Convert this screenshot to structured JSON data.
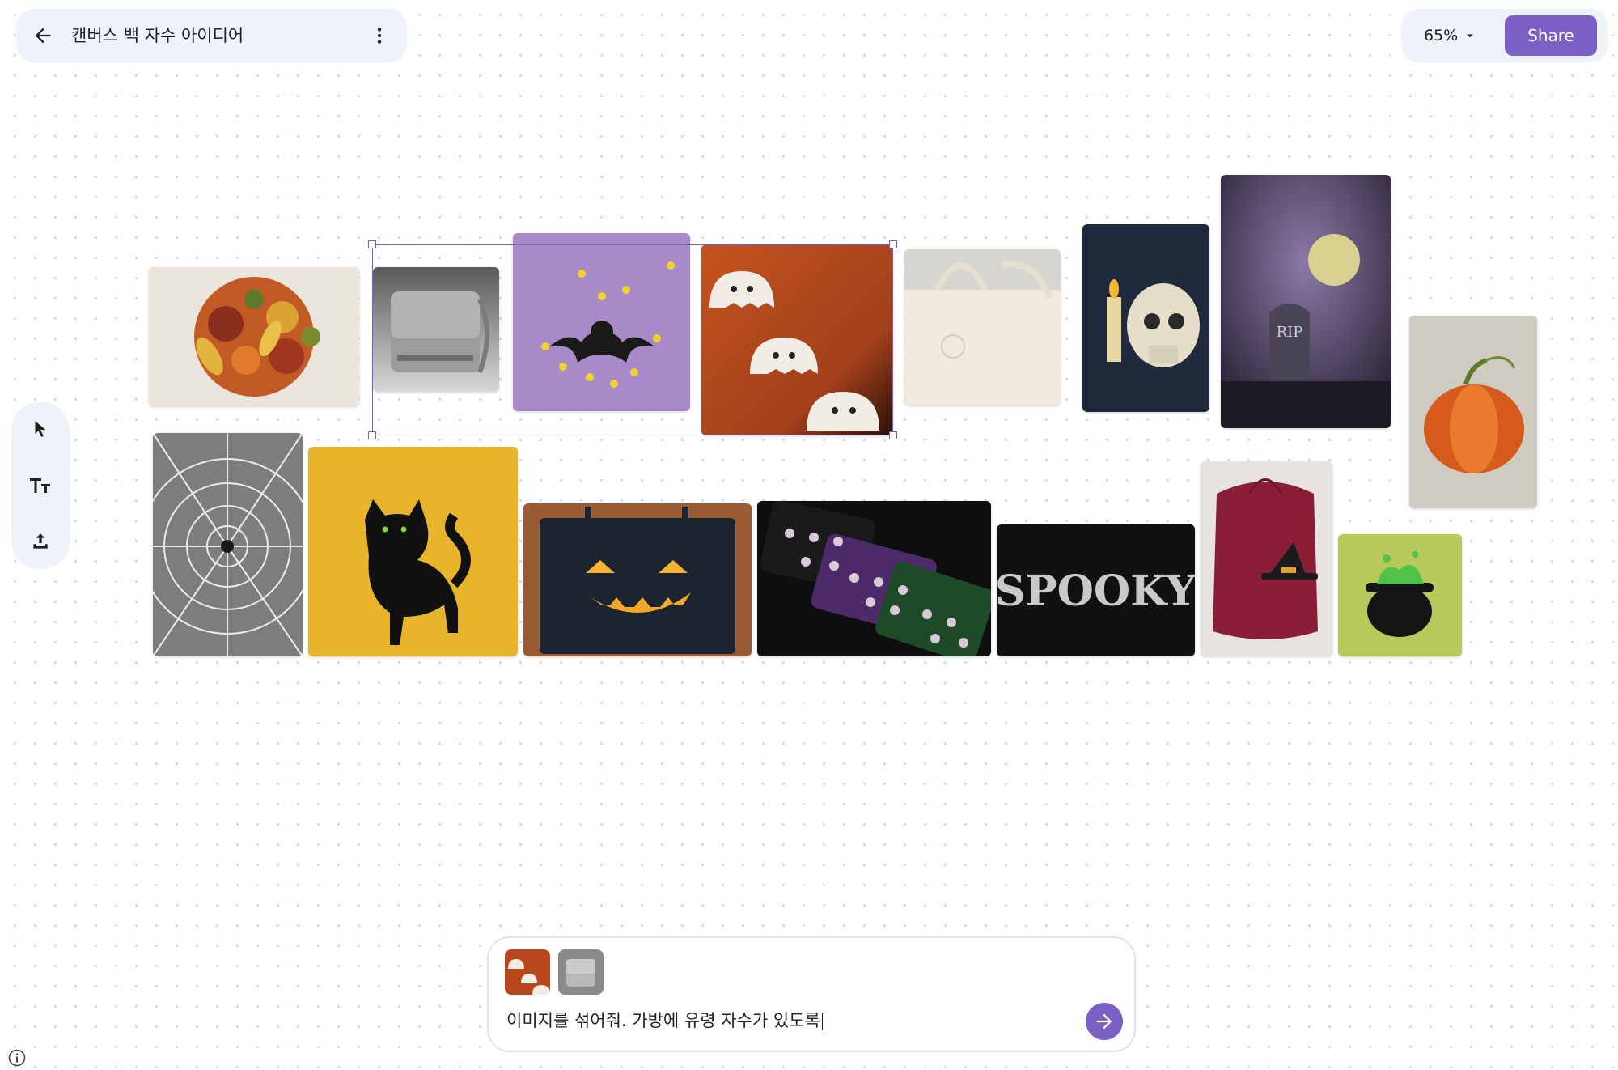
{
  "header": {
    "title": "캔버스 백 자수 아이디어",
    "back_icon": "arrow-back-icon",
    "more_icon": "more-vert-icon"
  },
  "top_right": {
    "zoom_label": "65%",
    "share_label": "Share",
    "accent_color": "#7b5fc4"
  },
  "toolbar": {
    "tools": [
      "select-cursor-icon",
      "text-tool-icon",
      "upload-icon"
    ]
  },
  "canvas": {
    "images": [
      "autumn harvest embroidery",
      "grey canvas messenger bag",
      "embroidered bat with stars",
      "embroidered ghosts on orange fabric",
      "cream tote bag with skull",
      "skull and candle embroidery",
      "graveyard moon RIP embroidery",
      "pumpkin embroidery",
      "spider web embroidery",
      "black cat on yellow",
      "jack-o-lantern tote bag",
      "eyeball pattern pouches",
      "SPOOKY lettering embroidery",
      "burgundy drawstring bag with witch hat",
      "witch cauldron embroidery"
    ],
    "tombstone_text": "RIP",
    "spooky_text": "SPOOKY"
  },
  "prompt": {
    "text": "이미지를 섞어줘. 가방에 유령 자수가 있도록",
    "attached": [
      "ghosts-thumbnail",
      "bag-thumbnail"
    ]
  }
}
